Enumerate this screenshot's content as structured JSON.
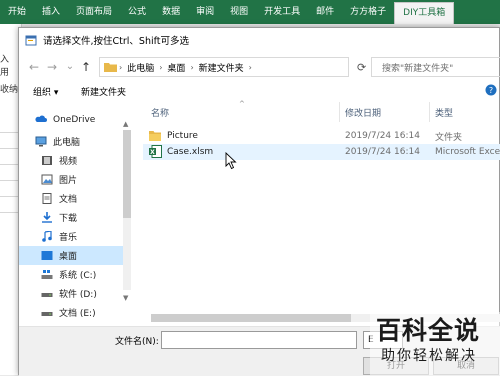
{
  "ribbon": {
    "tabs": [
      "开始",
      "插入",
      "页面布局",
      "公式",
      "数据",
      "审阅",
      "视图",
      "开发工具",
      "邮件",
      "方方格子",
      "DIY工具箱"
    ]
  },
  "excel_bg": {
    "fragments": [
      "入",
      "用",
      "收纳"
    ]
  },
  "dialog": {
    "title": "请选择文件,按住Ctrl、Shift可多选",
    "nav": {
      "back": "←",
      "forward": "→",
      "dropdown": "⌄",
      "up": "↑"
    },
    "breadcrumb": [
      "此电脑",
      "桌面",
      "新建文件夹"
    ],
    "search_placeholder": "搜索\"新建文件夹\"",
    "toolbar": {
      "organize": "组织 ▾",
      "new_folder": "新建文件夹"
    },
    "sidebar": [
      {
        "label": "OneDrive",
        "icon": "cloud-icon"
      },
      {
        "label": "此电脑",
        "icon": "computer-icon"
      },
      {
        "label": "视频",
        "icon": "video-icon"
      },
      {
        "label": "图片",
        "icon": "picture-icon"
      },
      {
        "label": "文档",
        "icon": "document-icon"
      },
      {
        "label": "下载",
        "icon": "download-icon"
      },
      {
        "label": "音乐",
        "icon": "music-icon"
      },
      {
        "label": "桌面",
        "icon": "desktop-icon",
        "selected": true
      },
      {
        "label": "系统 (C:)",
        "icon": "system-drive-icon"
      },
      {
        "label": "软件 (D:)",
        "icon": "drive-icon"
      },
      {
        "label": "文档 (E:)",
        "icon": "drive-icon"
      }
    ],
    "columns": {
      "name": "名称",
      "date": "修改日期",
      "type": "类型"
    },
    "files": [
      {
        "name": "Picture",
        "date": "2019/7/24 16:14",
        "type": "文件夹",
        "icon": "folder-icon"
      },
      {
        "name": "Case.xlsm",
        "date": "2019/7/24 16:14",
        "type": "Microsoft Exce",
        "icon": "excel-file-icon"
      }
    ],
    "filename_label": "文件名(N):",
    "filename_value": "",
    "filetype_value": "E",
    "buttons": {
      "open": "打开",
      "cancel": "取消"
    }
  },
  "watermark": {
    "big": "百科全说",
    "small": "助你轻松解决"
  }
}
